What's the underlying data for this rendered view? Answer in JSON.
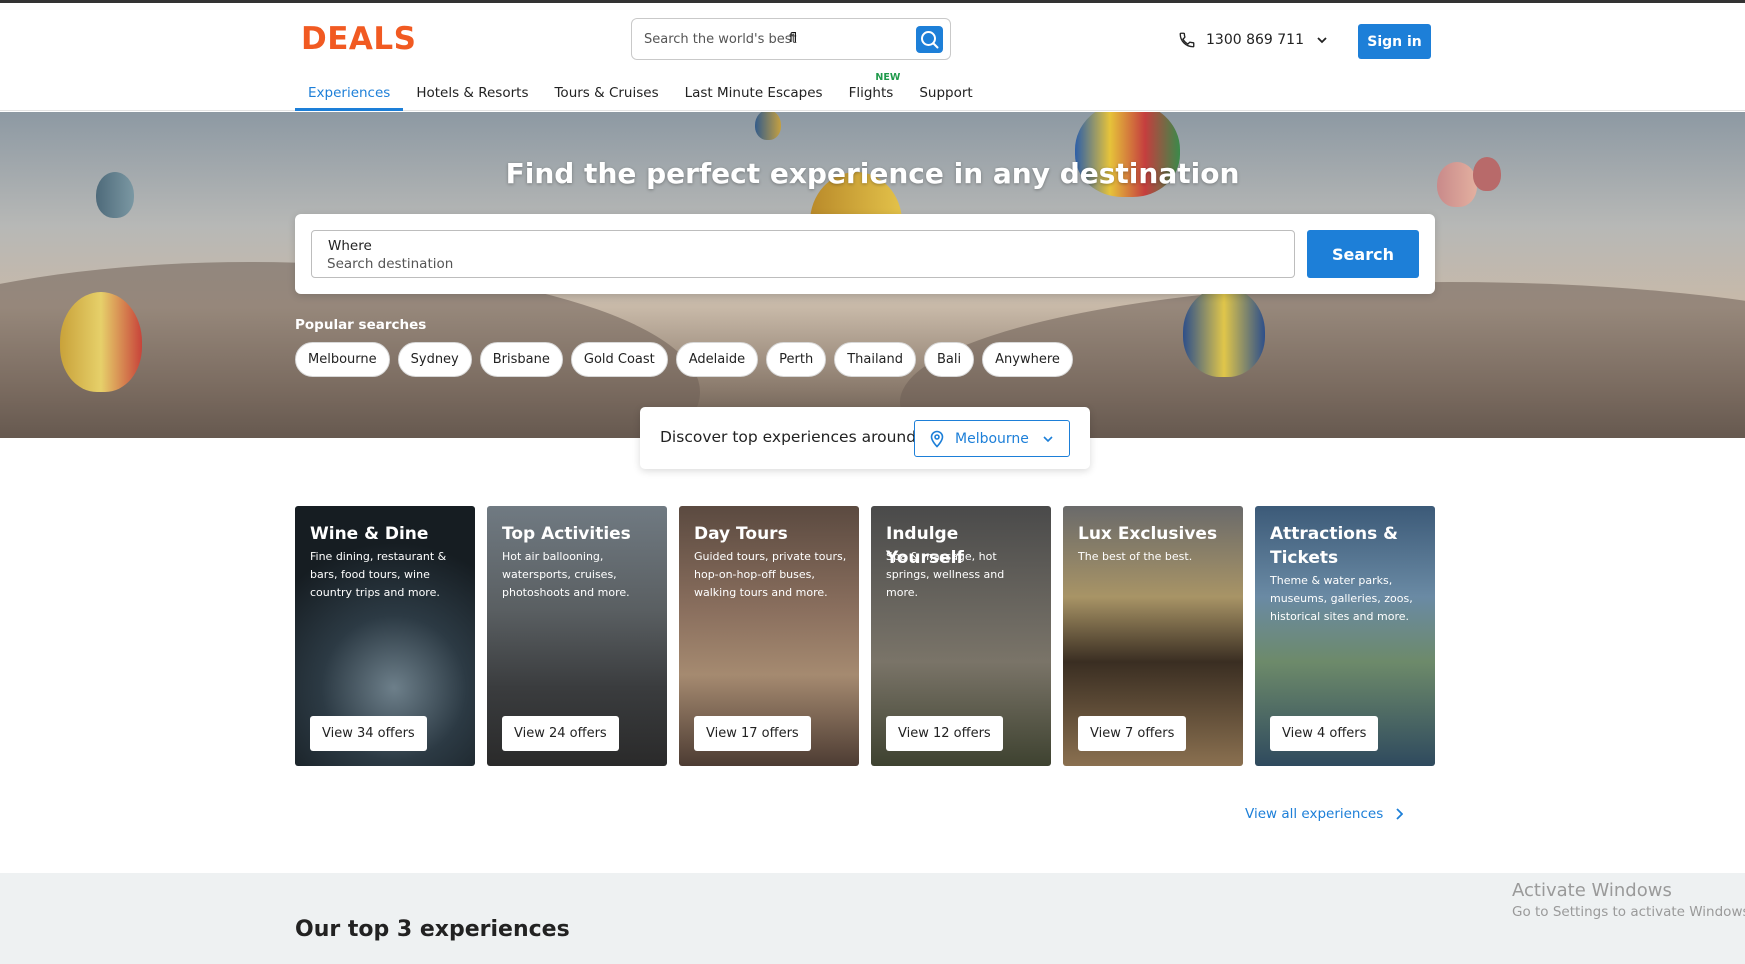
{
  "header": {
    "logo": "DEALS",
    "search": {
      "placeholder": "Search the world's best",
      "typed_value": "fl"
    },
    "phone": "1300 869 711",
    "sign_in": "Sign in",
    "nav": [
      {
        "label": "Experiences",
        "active": true
      },
      {
        "label": "Hotels & Resorts"
      },
      {
        "label": "Tours & Cruises"
      },
      {
        "label": "Last Minute Escapes"
      },
      {
        "label": "Flights",
        "badge": "NEW"
      },
      {
        "label": "Support"
      }
    ]
  },
  "hero": {
    "title": "Find the perfect experience in any destination",
    "where_label": "Where",
    "where_placeholder": "Search destination",
    "search_button": "Search",
    "popular_label": "Popular searches",
    "popular": [
      "Melbourne",
      "Sydney",
      "Brisbane",
      "Gold Coast",
      "Adelaide",
      "Perth",
      "Thailand",
      "Bali",
      "Anywhere"
    ]
  },
  "discover": {
    "label": "Discover top experiences around",
    "location": "Melbourne"
  },
  "categories": [
    {
      "title": "Wine & Dine",
      "desc": "Fine dining, restaurant & bars, food tours, wine country trips and more.",
      "button": "View 34 offers"
    },
    {
      "title": "Top Activities",
      "desc": "Hot air ballooning, watersports, cruises, photoshoots and more.",
      "button": "View 24 offers"
    },
    {
      "title": "Day Tours",
      "desc": "Guided tours, private tours, hop-on-hop-off buses, walking tours and more.",
      "button": "View 17 offers"
    },
    {
      "title": "Indulge Yourself",
      "desc": "Spa & massage, hot springs, wellness and more.",
      "button": "View 12 offers"
    },
    {
      "title": "Lux Exclusives",
      "desc": "The best of the best.",
      "button": "View 7 offers"
    },
    {
      "title": "Attractions & Tickets",
      "desc": "Theme & water parks, museums, galleries, zoos, historical sites and more.",
      "button": "View 4 offers"
    }
  ],
  "view_all": "View all experiences",
  "top3_title": "Our top 3 experiences",
  "watermark": {
    "line1": "Activate Windows",
    "line2": "Go to Settings to activate Windows."
  },
  "colors": {
    "brand": "#f15a22",
    "accent": "#1d7fd8",
    "new_badge": "#1f9a4b"
  }
}
